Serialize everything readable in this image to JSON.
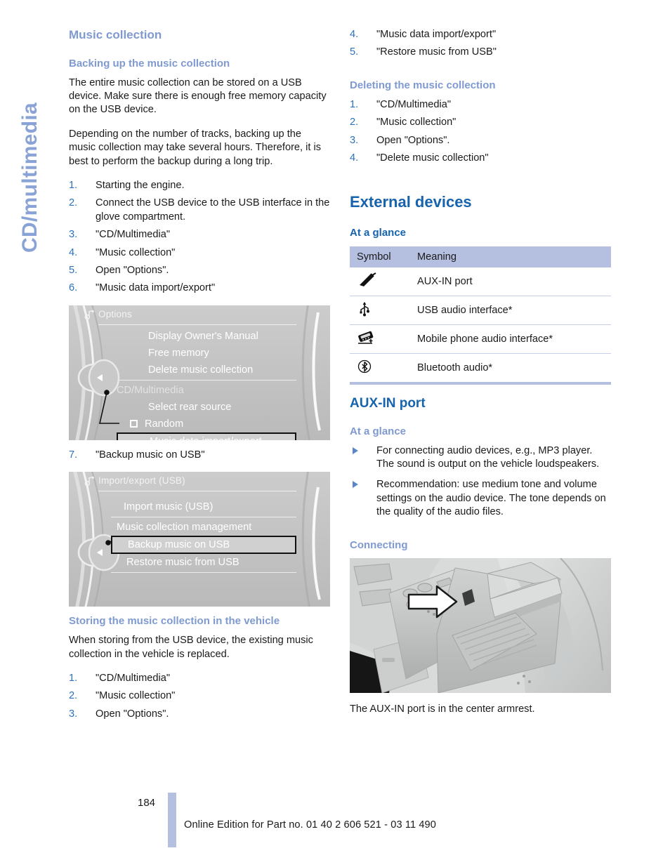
{
  "chapter_tab": {
    "label": "CD/multimedia"
  },
  "left_column": {
    "heading": "Music collection",
    "backup_section": {
      "heading": "Backing up the music collection",
      "paragraphs": [
        "The entire music collection can be stored on a USB device. Make sure there is enough free memory capacity on the USB device.",
        "Depending on the number of tracks, backing up the music collection may take several hours. Therefore, it is best to perform the backup during a long trip."
      ],
      "steps": [
        {
          "num": "1.",
          "text": "Starting the engine."
        },
        {
          "num": "2.",
          "text": "Connect the USB device to the USB interface in the glove compartment."
        },
        {
          "num": "3.",
          "text": "\"CD/Multimedia\""
        },
        {
          "num": "4.",
          "text": "\"Music collection\""
        },
        {
          "num": "5.",
          "text": "Open \"Options\"."
        },
        {
          "num": "6.",
          "text": "\"Music data import/export\""
        }
      ],
      "step7": {
        "num": "7.",
        "text": "\"Backup music on USB\""
      }
    },
    "idrive_options": {
      "title": "Options",
      "items": [
        {
          "label": "Display Owner's Manual",
          "style": "normal"
        },
        {
          "label": "Free memory",
          "style": "normal"
        },
        {
          "label": "Delete music collection",
          "style": "normal"
        },
        {
          "label": "CD/Multimedia",
          "style": "dim"
        },
        {
          "label": "Select rear source",
          "style": "normal"
        },
        {
          "label": "Random",
          "style": "checkbox"
        },
        {
          "label": "Music data import/export",
          "style": "selected"
        }
      ]
    },
    "idrive_importexport": {
      "title": "Import/export (USB)",
      "items": [
        {
          "label": "Import music (USB)",
          "style": "normal"
        },
        {
          "label": "Music collection management",
          "style": "normal"
        },
        {
          "label": "Backup music on USB",
          "style": "selected"
        },
        {
          "label": "Restore music from USB",
          "style": "normal"
        }
      ]
    },
    "storing_section": {
      "heading": "Storing the music collection in the vehicle",
      "paragraph": "When storing from the USB device, the existing music collection in the vehicle is replaced.",
      "steps": [
        {
          "num": "1.",
          "text": "\"CD/Multimedia\""
        },
        {
          "num": "2.",
          "text": "\"Music collection\""
        },
        {
          "num": "3.",
          "text": "Open \"Options\"."
        }
      ]
    }
  },
  "right_column": {
    "storing_steps_continued": [
      {
        "num": "4.",
        "text": "\"Music data import/export\""
      },
      {
        "num": "5.",
        "text": "\"Restore music from USB\""
      }
    ],
    "deleting_section": {
      "heading": "Deleting the music collection",
      "steps": [
        {
          "num": "1.",
          "text": "\"CD/Multimedia\""
        },
        {
          "num": "2.",
          "text": "\"Music collection\""
        },
        {
          "num": "3.",
          "text": "Open \"Options\"."
        },
        {
          "num": "4.",
          "text": "\"Delete music collection\""
        }
      ]
    },
    "external_devices": {
      "heading": "External devices",
      "at_a_glance_heading": "At a glance",
      "table": {
        "columns": [
          "Symbol",
          "Meaning"
        ],
        "rows": [
          {
            "icon": "aux-plug-icon",
            "meaning": "AUX-IN port"
          },
          {
            "icon": "usb-icon",
            "meaning": "USB audio interface*"
          },
          {
            "icon": "mobile-phone-audio-icon",
            "meaning": "Mobile phone audio interface*"
          },
          {
            "icon": "bluetooth-icon",
            "meaning": "Bluetooth audio*"
          }
        ]
      }
    },
    "aux_in_port": {
      "heading": "AUX-IN port",
      "at_a_glance_heading": "At a glance",
      "bullets": [
        "For connecting audio devices, e.g., MP3 player. The sound is output on the vehicle loudspeakers.",
        "Recommendation: use medium tone and volume settings on the audio device. The tone depends on the quality of the audio files."
      ],
      "connecting_heading": "Connecting",
      "photo_caption": "The AUX-IN port is in the center armrest."
    }
  },
  "footer": {
    "page_number": "184",
    "edition_text": "Online Edition for Part no. 01 40 2 606 521 - 03 11 490"
  },
  "colors": {
    "heading_dark_blue": "#1763ad",
    "heading_light_blue": "#7f9ad1",
    "list_number_blue": "#2a72bd",
    "table_header_bg": "#b5bfe0",
    "table_rule": "#c6cfe8",
    "tab_blue": "#8aa3d6"
  }
}
